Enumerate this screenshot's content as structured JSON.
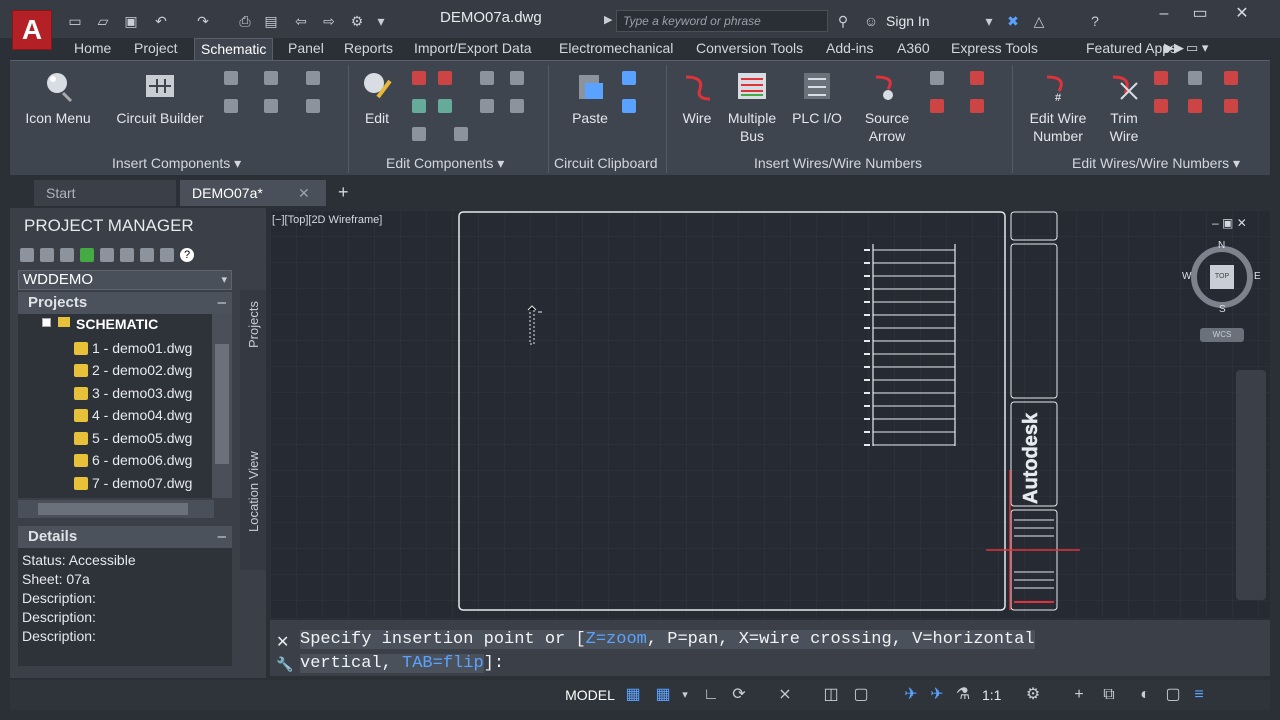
{
  "app": {
    "logo": "A",
    "document_title": "DEMO07a.dwg",
    "search_placeholder": "Type a keyword or phrase",
    "sign_in": "Sign In"
  },
  "ribbon_tabs": [
    "Home",
    "Project",
    "Schematic",
    "Panel",
    "Reports",
    "Import/Export Data",
    "Electromechanical",
    "Conversion Tools",
    "Add-ins",
    "A360",
    "Express Tools",
    "Featured Apps"
  ],
  "active_tab": "Schematic",
  "ribbon": {
    "buttons": {
      "icon_menu": "Icon Menu",
      "circuit_builder": "Circuit Builder",
      "edit": "Edit",
      "paste": "Paste",
      "wire": "Wire",
      "multiple_bus_1": "Multiple",
      "multiple_bus_2": "Bus",
      "plc_io": "PLC I/O",
      "source_arrow_1": "Source",
      "source_arrow_2": "Arrow",
      "edit_wire_number_1": "Edit Wire",
      "edit_wire_number_2": "Number",
      "trim_wire_1": "Trim",
      "trim_wire_2": "Wire"
    },
    "groups": {
      "insert_components": "Insert Components",
      "edit_components": "Edit Components",
      "circuit_clipboard": "Circuit Clipboard",
      "insert_wires": "Insert Wires/Wire Numbers",
      "edit_wires": "Edit Wires/Wire Numbers"
    }
  },
  "file_tabs": {
    "start": "Start",
    "current": "DEMO07a*"
  },
  "project_manager": {
    "title": "PROJECT MANAGER",
    "selected_project": "WDDEMO",
    "projects_header": "Projects",
    "side_tabs": {
      "projects": "Projects",
      "location_view": "Location View"
    },
    "tree_root": "SCHEMATIC",
    "files": [
      "1 - demo01.dwg",
      "2 - demo02.dwg",
      "3 - demo03.dwg",
      "4 - demo04.dwg",
      "5 - demo05.dwg",
      "6 - demo06.dwg",
      "7 - demo07.dwg"
    ],
    "details_header": "Details",
    "details": [
      "Status: Accessible",
      "Sheet: 07a",
      "Description:",
      "Description:",
      "Description:"
    ]
  },
  "viewport": {
    "label": "[−][Top][2D Wireframe]",
    "navcube": {
      "n": "N",
      "s": "S",
      "e": "E",
      "w": "W",
      "top": "TOP",
      "wcs": "WCS"
    },
    "titleblock_text": "Autodesk"
  },
  "command_line": {
    "prefix": "Specify insertion point or [",
    "opt1": "Z=zoom",
    "mid1": ", P=pan, X=wire crossing, V=horizontal",
    "line2_start": "vertical, ",
    "opt2": "TAB=flip",
    "line2_end": "]:"
  },
  "status": {
    "model": "MODEL",
    "scale": "1:1"
  },
  "colors": {
    "accent": "#5aa2ff",
    "logo": "#b32025",
    "wire_red": "#e0323a"
  }
}
